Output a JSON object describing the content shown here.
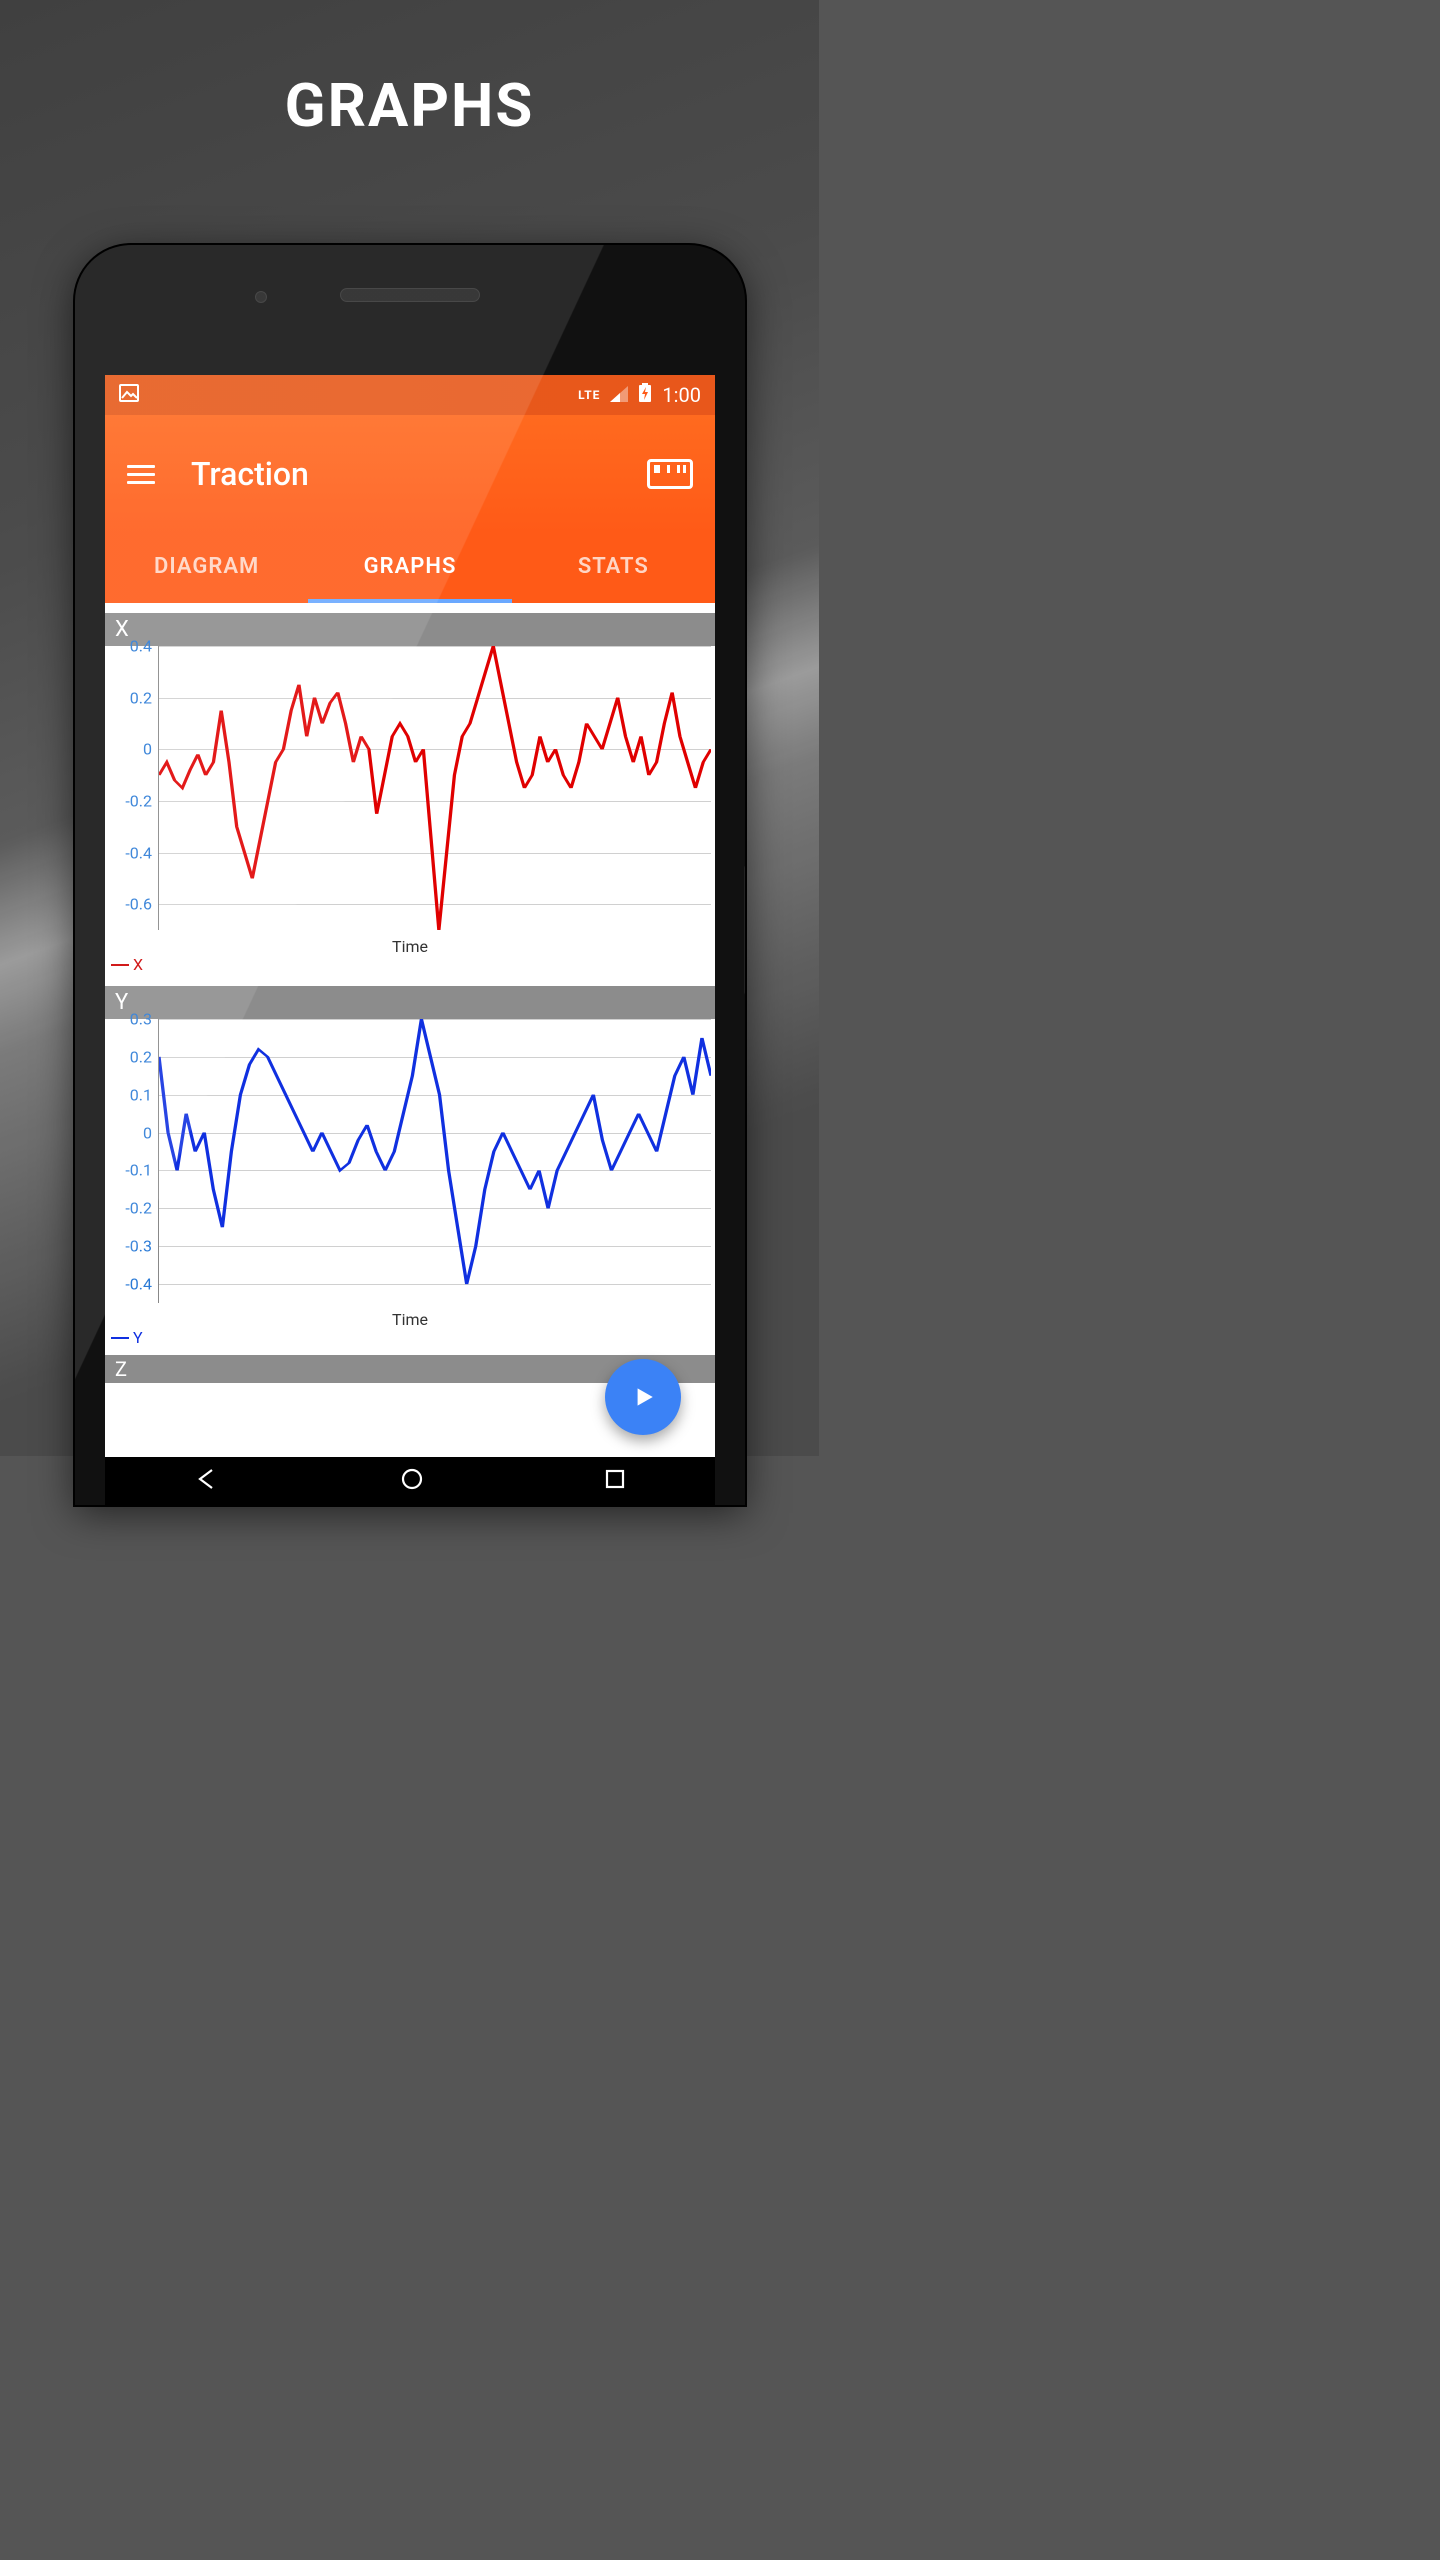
{
  "page_heading": "GRAPHS",
  "statusbar": {
    "network": "LTE",
    "time": "1:00"
  },
  "appbar": {
    "title": "Traction"
  },
  "tabs": [
    {
      "label": "DIAGRAM",
      "active": false
    },
    {
      "label": "GRAPHS",
      "active": true
    },
    {
      "label": "STATS",
      "active": false
    }
  ],
  "fab": {
    "label": "Play"
  },
  "charts": {
    "x": {
      "header": "X",
      "xlabel": "Time",
      "legend": "X",
      "y_ticks": [
        0.4,
        0.2,
        0,
        -0.2,
        -0.4,
        -0.6
      ],
      "color": "#e00000"
    },
    "y": {
      "header": "Y",
      "xlabel": "Time",
      "legend": "Y",
      "y_ticks": [
        0.3,
        0.2,
        0.1,
        0,
        -0.1,
        -0.2,
        -0.3,
        -0.4
      ],
      "color": "#1030e0"
    },
    "z_peek": "Z"
  },
  "chart_data": [
    {
      "type": "line",
      "title": "X",
      "xlabel": "Time",
      "ylabel": "",
      "ylim": [
        -0.7,
        0.4
      ],
      "series": [
        {
          "name": "X",
          "color": "#e00000",
          "values": [
            -0.1,
            -0.05,
            -0.12,
            -0.15,
            -0.08,
            -0.02,
            -0.1,
            -0.05,
            0.15,
            -0.05,
            -0.3,
            -0.4,
            -0.5,
            -0.35,
            -0.2,
            -0.05,
            0.0,
            0.15,
            0.25,
            0.05,
            0.2,
            0.1,
            0.18,
            0.22,
            0.1,
            -0.05,
            0.05,
            0.0,
            -0.25,
            -0.1,
            0.05,
            0.1,
            0.05,
            -0.05,
            0.0,
            -0.35,
            -0.7,
            -0.4,
            -0.1,
            0.05,
            0.1,
            0.2,
            0.3,
            0.4,
            0.25,
            0.1,
            -0.05,
            -0.15,
            -0.1,
            0.05,
            -0.05,
            0.0,
            -0.1,
            -0.15,
            -0.05,
            0.1,
            0.05,
            0.0,
            0.1,
            0.2,
            0.05,
            -0.05,
            0.05,
            -0.1,
            -0.05,
            0.1,
            0.22,
            0.05,
            -0.05,
            -0.15,
            -0.05,
            0.0
          ]
        }
      ]
    },
    {
      "type": "line",
      "title": "Y",
      "xlabel": "Time",
      "ylabel": "",
      "ylim": [
        -0.45,
        0.3
      ],
      "series": [
        {
          "name": "Y",
          "color": "#1030e0",
          "values": [
            0.2,
            0.0,
            -0.1,
            0.05,
            -0.05,
            0.0,
            -0.15,
            -0.25,
            -0.05,
            0.1,
            0.18,
            0.22,
            0.2,
            0.15,
            0.1,
            0.05,
            0.0,
            -0.05,
            0.0,
            -0.05,
            -0.1,
            -0.08,
            -0.02,
            0.02,
            -0.05,
            -0.1,
            -0.05,
            0.05,
            0.15,
            0.3,
            0.2,
            0.1,
            -0.1,
            -0.25,
            -0.4,
            -0.3,
            -0.15,
            -0.05,
            0.0,
            -0.05,
            -0.1,
            -0.15,
            -0.1,
            -0.2,
            -0.1,
            -0.05,
            0.0,
            0.05,
            0.1,
            -0.02,
            -0.1,
            -0.05,
            0.0,
            0.05,
            0.0,
            -0.05,
            0.05,
            0.15,
            0.2,
            0.1,
            0.25,
            0.15
          ]
        }
      ]
    }
  ]
}
